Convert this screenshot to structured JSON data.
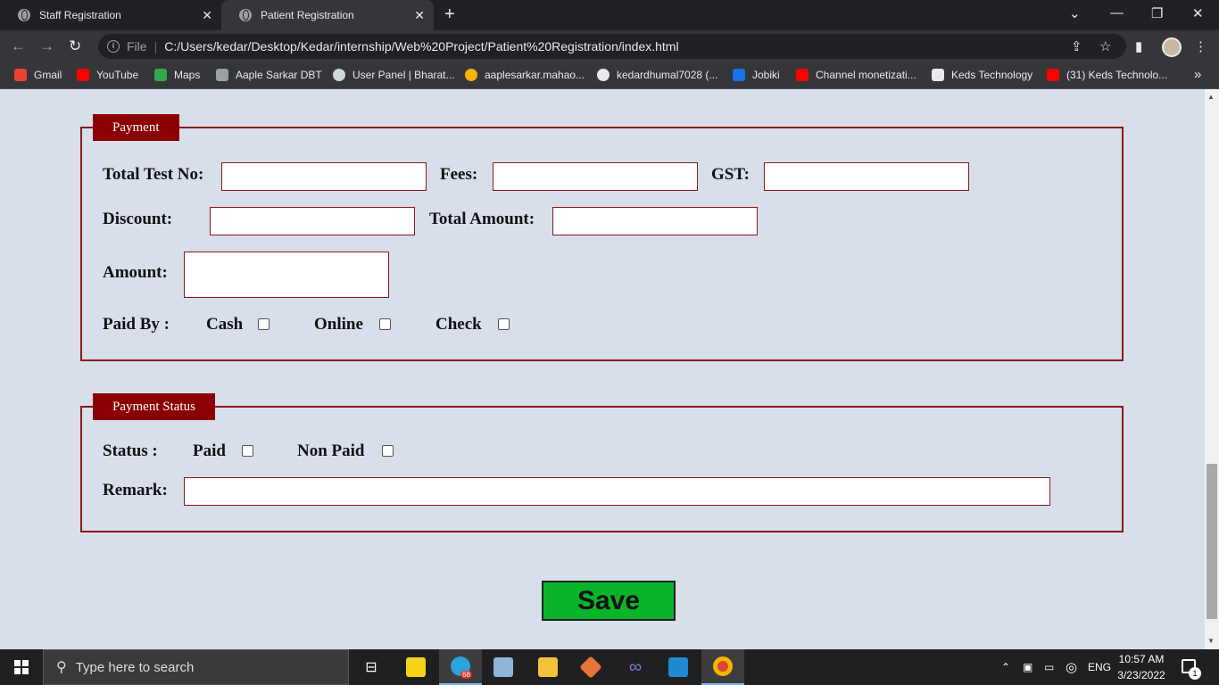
{
  "browser": {
    "tabs": [
      {
        "title": "Staff Registration",
        "active": false
      },
      {
        "title": "Patient Registration",
        "active": true
      }
    ],
    "new_tab": "+",
    "address": {
      "scheme_label": "File",
      "url": "C:/Users/kedar/Desktop/Kedar/internship/Web%20Project/Patient%20Registration/index.html"
    },
    "bookmarks": [
      {
        "label": "Gmail",
        "color": "#ea4335"
      },
      {
        "label": "YouTube",
        "color": "#ff0000"
      },
      {
        "label": "Maps",
        "color": "#34a853"
      },
      {
        "label": "Aaple Sarkar DBT",
        "color": "#9aa0a6"
      },
      {
        "label": "User Panel | Bharat...",
        "color": "#cfd8dc"
      },
      {
        "label": "aaplesarkar.mahao...",
        "color": "#f5b400"
      },
      {
        "label": "kedardhumal7028 (...",
        "color": "#e8eaed"
      },
      {
        "label": "Jobiki",
        "color": "#1a73e8"
      },
      {
        "label": "Channel monetizati...",
        "color": "#ff0000"
      },
      {
        "label": "Keds Technology",
        "color": "#e8eaed"
      },
      {
        "label": "(31) Keds Technolo...",
        "color": "#ff0000"
      }
    ],
    "bookmarks_overflow": "»"
  },
  "payment": {
    "legend": "Payment",
    "total_test_label": "Total Test No:",
    "fees_label": "Fees:",
    "gst_label": "GST:",
    "discount_label": "Discount:",
    "total_amount_label": "Total Amount:",
    "amount_label": "Amount:",
    "paid_by_label": "Paid By :",
    "options": [
      "Cash",
      "Online",
      "Check"
    ]
  },
  "payment_status": {
    "legend": "Payment Status",
    "status_label": "Status :",
    "options": [
      "Paid",
      "Non Paid"
    ],
    "remark_label": "Remark:"
  },
  "save_label": "Save",
  "taskbar": {
    "search_placeholder": "Type here to search",
    "telegram_badge": "68",
    "language": "ENG",
    "time": "10:57 AM",
    "date": "3/23/2022",
    "notification_count": "1"
  },
  "colors": {
    "accent": "#8b0000",
    "page_bg": "#d6dfea",
    "save_button": "#0ab42a"
  }
}
